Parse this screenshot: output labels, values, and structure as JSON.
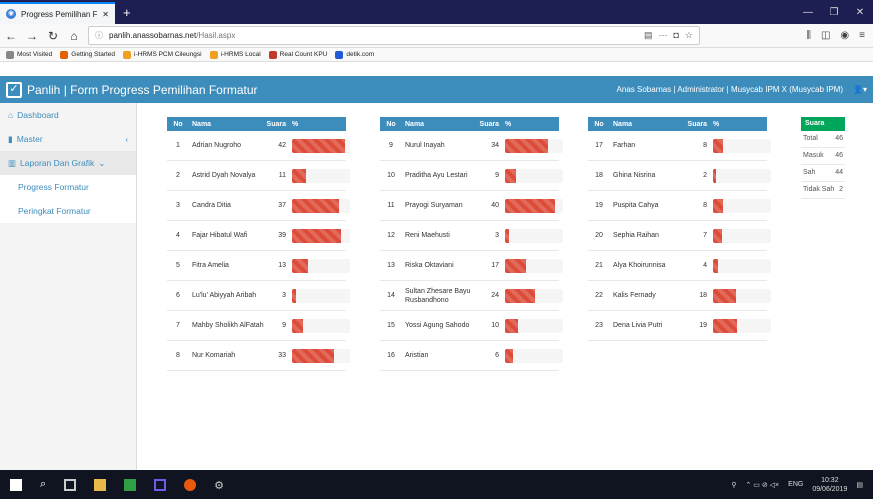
{
  "browser": {
    "tab_title": "Progress Pemilihan Formatur",
    "url_domain": "panlih.anassobarnas.net",
    "url_path": "/Hasil.aspx"
  },
  "bookmarks": [
    {
      "label": "Most Visited",
      "color": "#888888"
    },
    {
      "label": "Getting Started",
      "color": "#e66000"
    },
    {
      "label": "i-HRMS PCM Cileungsi",
      "color": "#f0a020"
    },
    {
      "label": "i-HRMS Local",
      "color": "#f0a020"
    },
    {
      "label": "Real Count KPU",
      "color": "#c0392b"
    },
    {
      "label": "detik.com",
      "color": "#1f5bd6"
    }
  ],
  "header": {
    "title": "Panlih | Form Progress Pemilihan Formatur",
    "user_info": "Anas Sobarnas | Administrator | Musycab IPM X (Musycab IPM)"
  },
  "sidebar": [
    {
      "label": "Dashboard",
      "icon": "home-icon"
    },
    {
      "label": "Master",
      "icon": "book-icon"
    },
    {
      "label": "Laporan Dan Grafik",
      "icon": "chart-icon"
    },
    {
      "label": "Progress Formatur"
    },
    {
      "label": "Peringkat Formatur"
    }
  ],
  "columns": {
    "no": "No",
    "nama": "Nama",
    "suara": "Suara",
    "pct": "%"
  },
  "colors": {
    "primary": "#3c8dbc",
    "danger": "#dd4b39",
    "success": "#00a65a"
  },
  "max_votes": 46,
  "candidates": [
    [
      {
        "no": "1",
        "nama": "Adrian Nugroho",
        "suara": 42
      },
      {
        "no": "2",
        "nama": "Astrid Dyah Novalya",
        "suara": 11
      },
      {
        "no": "3",
        "nama": "Candra Ditia",
        "suara": 37
      },
      {
        "no": "4",
        "nama": "Fajar Hibatul Wafi",
        "suara": 39
      },
      {
        "no": "5",
        "nama": "Fitra Amelia",
        "suara": 13
      },
      {
        "no": "6",
        "nama": "Lu'lu' Abiyyah Aribah",
        "suara": 3
      },
      {
        "no": "7",
        "nama": "Mahby Sholikh AlFatah",
        "suara": 9
      },
      {
        "no": "8",
        "nama": "Nur Komariah",
        "suara": 33
      }
    ],
    [
      {
        "no": "9",
        "nama": "Nurul Inayah",
        "suara": 34
      },
      {
        "no": "10",
        "nama": "Praditha Ayu Lestari",
        "suara": 9
      },
      {
        "no": "11",
        "nama": "Prayogi Suryaman",
        "suara": 40
      },
      {
        "no": "12",
        "nama": "Reni Maehusti",
        "suara": 3
      },
      {
        "no": "13",
        "nama": "Riska Oktaviani",
        "suara": 17
      },
      {
        "no": "14",
        "nama": "Sultan Zhesare Bayu Rusbandhono",
        "suara": 24
      },
      {
        "no": "15",
        "nama": "Yossi Agung Sahodo",
        "suara": 10
      },
      {
        "no": "16",
        "nama": "Aristian",
        "suara": 6
      }
    ],
    [
      {
        "no": "17",
        "nama": "Farhan",
        "suara": 8
      },
      {
        "no": "18",
        "nama": "Ghina Nisrina",
        "suara": 2
      },
      {
        "no": "19",
        "nama": "Puspita Cahya",
        "suara": 8
      },
      {
        "no": "20",
        "nama": "Sephia Raihan",
        "suara": 7
      },
      {
        "no": "21",
        "nama": "Alya Khoirunnisa",
        "suara": 4
      },
      {
        "no": "22",
        "nama": "Kalis Fernady",
        "suara": 18
      },
      {
        "no": "23",
        "nama": "Dena Livia Putri",
        "suara": 19
      }
    ]
  ],
  "summary": {
    "header": "Suara",
    "rows": [
      {
        "label": "Total",
        "value": "46"
      },
      {
        "label": "Masuk",
        "value": "46"
      },
      {
        "label": "Sah",
        "value": "44"
      },
      {
        "label": "Tidak Sah",
        "value": "2"
      }
    ]
  },
  "taskbar": {
    "lang": "ENG",
    "time": "10:32",
    "date": "09/06/2019"
  }
}
